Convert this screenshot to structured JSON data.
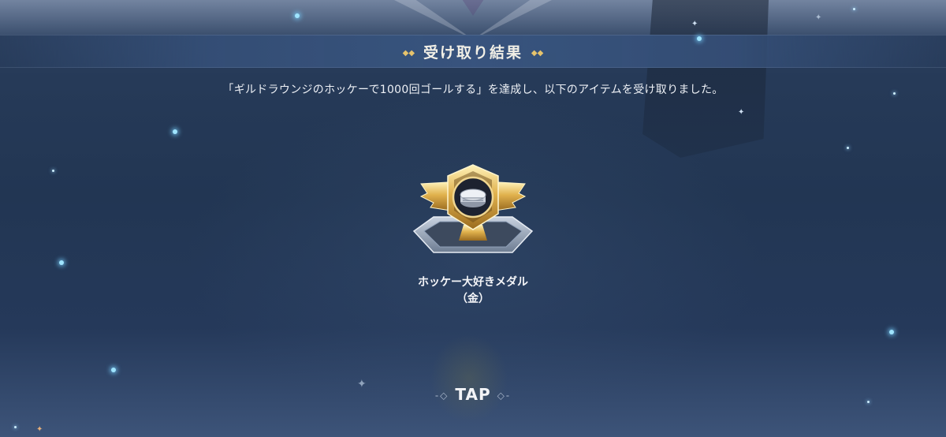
{
  "result_title": "受け取り結果",
  "message": "「ギルドラウンジのホッケーで1000回ゴールする」を達成し、以下のアイテムを受け取りました。",
  "reward": {
    "name_line1": "ホッケー大好きメダル",
    "name_line2": "（金）",
    "icon": "gold-hockey-puck-medal-icon"
  },
  "tap_prompt": "TAP",
  "colors": {
    "banner": "#38547e",
    "gold_accent": "#e6c36c",
    "background": "#24364f",
    "text": "#eef1f6"
  }
}
